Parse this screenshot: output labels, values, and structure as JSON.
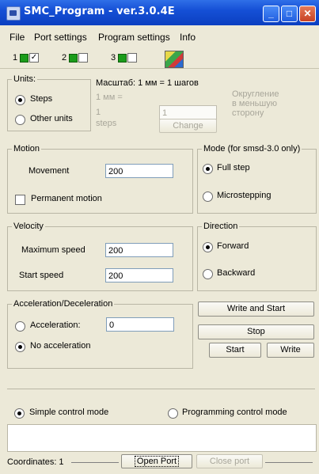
{
  "window": {
    "title": "SMC_Program - ver.3.0.4E"
  },
  "menu": [
    "File",
    "Port settings",
    "Program settings",
    "Info"
  ],
  "axes": [
    {
      "num": "1",
      "checked": true
    },
    {
      "num": "2",
      "checked": false
    },
    {
      "num": "3",
      "checked": false
    }
  ],
  "units": {
    "legend": "Units:",
    "steps": "Steps",
    "other_units": "Other units",
    "scale_title": "Масштаб: 1 мм = 1 шагов",
    "one_mm": "1 мм =",
    "one": "1",
    "steps_word": "steps",
    "input_value": "1",
    "change": "Change",
    "rounding": [
      "Округление",
      "в меньшую",
      "сторону"
    ]
  },
  "motion": {
    "legend": "Motion",
    "movement_label": "Movement",
    "movement_value": "200",
    "permanent": "Permanent motion"
  },
  "mode": {
    "legend": "Mode (for smsd-3.0 only)",
    "full_step": "Full step",
    "microstepping": "Microstepping"
  },
  "velocity": {
    "legend": "Velocity",
    "max_label": "Maximum speed",
    "max_value": "200",
    "start_label": "Start speed",
    "start_value": "200"
  },
  "direction": {
    "legend": "Direction",
    "forward": "Forward",
    "backward": "Backward"
  },
  "accel": {
    "legend": "Acceleration/Deceleration",
    "acceleration": "Acceleration:",
    "value": "0",
    "none": "No acceleration"
  },
  "buttons": {
    "write_start": "Write and Start",
    "stop": "Stop",
    "start": "Start",
    "write": "Write"
  },
  "control": {
    "simple": "Simple control mode",
    "programming": "Programming control mode"
  },
  "status": {
    "coordinates": "Coordinates:  1",
    "open_port": "Open Port",
    "close_port": "Close port"
  }
}
